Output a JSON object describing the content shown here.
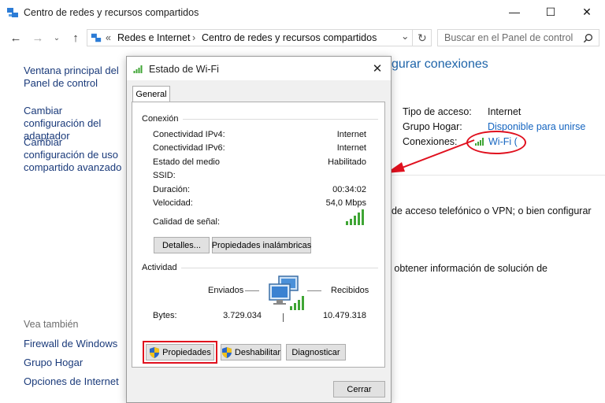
{
  "window": {
    "title": "Centro de redes y recursos compartidos",
    "controls": {
      "minimize": "—",
      "maximize": "☐",
      "close": "✕"
    }
  },
  "addressbar": {
    "back": "←",
    "forward": "→",
    "up": "↑",
    "overflow": "«",
    "crumbs": [
      "Redes e Internet",
      "Centro de redes y recursos compartidos"
    ],
    "separator": "›",
    "dropdown": "⌄",
    "refresh": "↻",
    "search_placeholder": "Buscar en el Panel de control",
    "search_icon": "search-icon"
  },
  "sidebar": {
    "links": [
      "Ventana principal del Panel de control",
      "Cambiar configuración del adaptador",
      "Cambiar configuración de uso compartido avanzado"
    ],
    "see_also_heading": "Vea también",
    "see_also": [
      "Firewall de Windows",
      "Grupo Hogar",
      "Opciones de Internet"
    ]
  },
  "main": {
    "heading_fragment": "gurar conexiones",
    "access_type_label": "Tipo de acceso:",
    "access_type_value": "Internet",
    "homegroup_label": "Grupo Hogar:",
    "homegroup_value": "Disponible para unirse",
    "connections_label": "Conexiones:",
    "connections_value": "Wi-Fi (",
    "text1": ", de acceso telefónico o VPN; o bien configurar",
    "text2": "u obtener información de solución de"
  },
  "dialog": {
    "title": "Estado de Wi-Fi",
    "close": "✕",
    "tab": "General",
    "connection_group": "Conexión",
    "rows": [
      {
        "label": "Conectividad IPv4:",
        "value": "Internet"
      },
      {
        "label": "Conectividad IPv6:",
        "value": "Internet"
      },
      {
        "label": "Estado del medio",
        "value": "Habilitado"
      },
      {
        "label": "SSID:",
        "value": ""
      },
      {
        "label": "Duración:",
        "value": "00:34:02"
      },
      {
        "label": "Velocidad:",
        "value": "54,0 Mbps"
      }
    ],
    "signal_label": "Calidad de señal:",
    "signal_level": 1.0,
    "details_button": "Detalles...",
    "wireless_props_button": "Propiedades inalámbricas",
    "activity_group": "Actividad",
    "sent_label": "Enviados",
    "received_label": "Recibidos",
    "bytes_label": "Bytes:",
    "bytes_sent": "3.729.034",
    "bytes_received": "10.479.318",
    "properties_button": "Propiedades",
    "disable_button": "Deshabilitar",
    "diagnose_button": "Diagnosticar",
    "close_button": "Cerrar"
  },
  "annotation": {
    "color": "#e0101e"
  },
  "colors": {
    "link": "#1565c0",
    "heading": "#1e64a9",
    "signal": "#3fa535"
  }
}
